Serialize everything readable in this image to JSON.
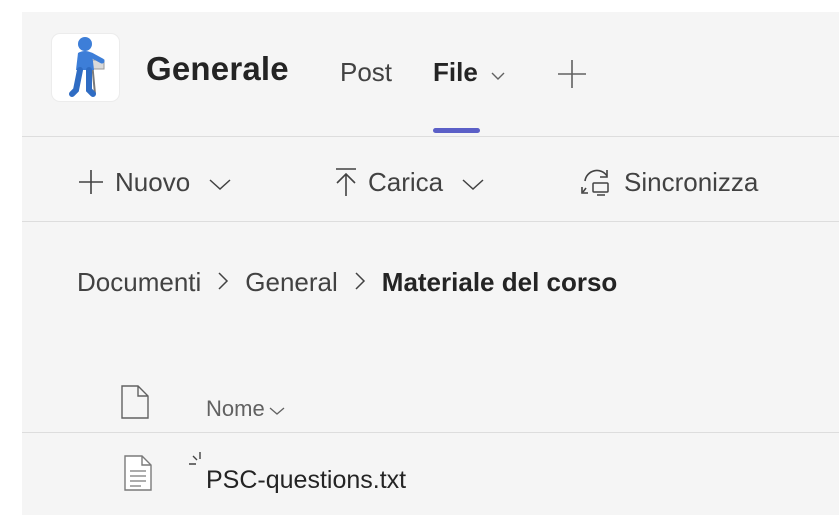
{
  "channel": {
    "name": "Generale",
    "avatar_icon": "pointing-stick-figure-icon"
  },
  "tabs": [
    {
      "label": "Post",
      "active": false
    },
    {
      "label": "File",
      "active": true,
      "has_dropdown": true
    }
  ],
  "tab_add_icon": "plus-icon",
  "accent_color": "#5b5fc7",
  "toolbar": {
    "new_label": "Nuovo",
    "upload_label": "Carica",
    "sync_label": "Sincronizza"
  },
  "breadcrumb": {
    "items": [
      "Documenti",
      "General"
    ],
    "current": "Materiale del corso",
    "separator": ">"
  },
  "file_list": {
    "name_column_label": "Nome",
    "rows": [
      {
        "name": "PSC-questions.txt",
        "icon": "text-file-icon",
        "is_new": true
      }
    ]
  }
}
